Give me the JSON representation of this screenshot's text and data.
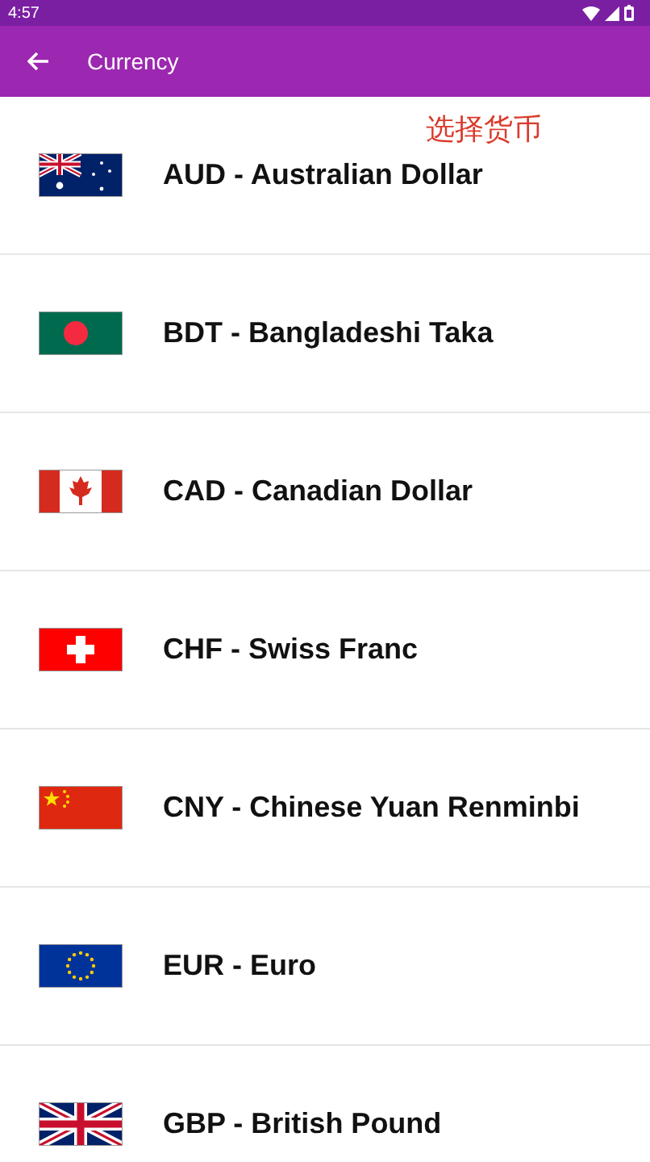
{
  "status_bar": {
    "time": "4:57"
  },
  "app_bar": {
    "title": "Currency"
  },
  "annotation": "选择货币",
  "currencies": [
    {
      "label": "AUD - Australian Dollar"
    },
    {
      "label": "BDT - Bangladeshi Taka"
    },
    {
      "label": "CAD - Canadian Dollar"
    },
    {
      "label": "CHF - Swiss Franc"
    },
    {
      "label": "CNY - Chinese Yuan Renminbi"
    },
    {
      "label": "EUR - Euro"
    },
    {
      "label": "GBP - British Pound"
    }
  ]
}
